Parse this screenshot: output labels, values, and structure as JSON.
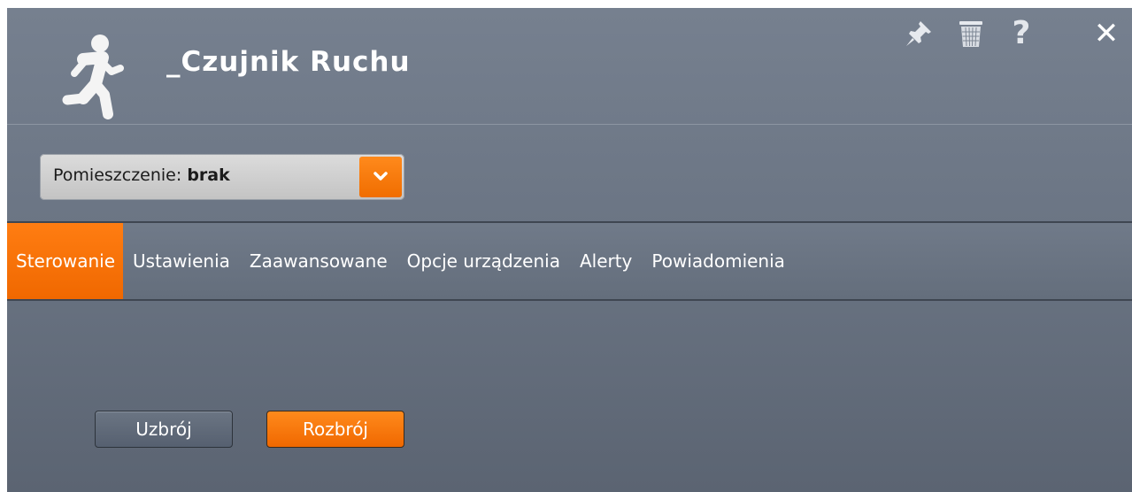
{
  "header": {
    "title": "_Czujnik Ruchu",
    "icons": {
      "device": "running-person-icon",
      "pin": "pin-icon",
      "trash": "trash-icon",
      "help": "?",
      "close": "✕"
    }
  },
  "room_selector": {
    "label": "Pomieszczenie:",
    "value": "brak",
    "dropdown_icon": "chevron-down-icon"
  },
  "tabs": [
    {
      "label": "Sterowanie",
      "active": true
    },
    {
      "label": "Ustawienia",
      "active": false
    },
    {
      "label": "Zaawansowane",
      "active": false
    },
    {
      "label": "Opcje urządzenia",
      "active": false
    },
    {
      "label": "Alerty",
      "active": false
    },
    {
      "label": "Powiadomienia",
      "active": false
    }
  ],
  "actions": {
    "arm_label": "Uzbrój",
    "disarm_label": "Rozbrój"
  },
  "colors": {
    "accent": "#f57200",
    "panel": "#6e7888"
  }
}
